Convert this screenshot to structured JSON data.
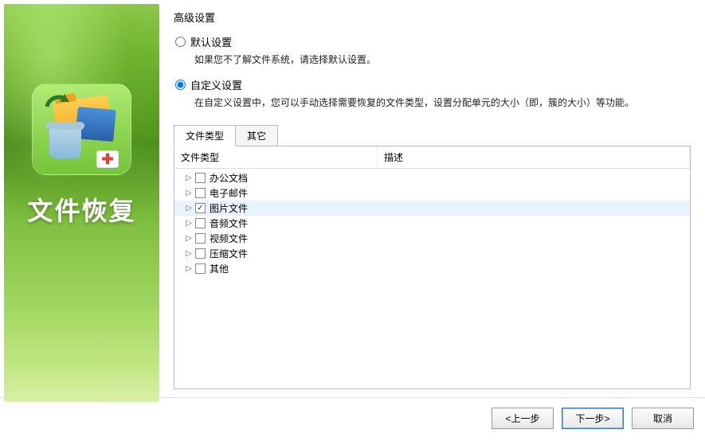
{
  "sidebar": {
    "title": "文件恢复"
  },
  "main": {
    "section_title": "高级设置",
    "options": {
      "default": {
        "label": "默认设置",
        "desc": "如果您不了解文件系统，请选择默认设置。",
        "selected": false
      },
      "custom": {
        "label": "自定义设置",
        "desc": "在自定义设置中，您可以手动选择需要恢复的文件类型，设置分配单元的大小（即，簇的大小）等功能。",
        "selected": true
      }
    },
    "tabs": [
      {
        "label": "文件类型",
        "active": true
      },
      {
        "label": "其它",
        "active": false
      }
    ],
    "columns": {
      "type": "文件类型",
      "desc": "描述"
    },
    "tree": [
      {
        "label": "办公文档",
        "checked": false,
        "selected": false
      },
      {
        "label": "电子邮件",
        "checked": false,
        "selected": false
      },
      {
        "label": "图片文件",
        "checked": true,
        "selected": true
      },
      {
        "label": "音频文件",
        "checked": false,
        "selected": false
      },
      {
        "label": "视频文件",
        "checked": false,
        "selected": false
      },
      {
        "label": "压缩文件",
        "checked": false,
        "selected": false
      },
      {
        "label": "其他",
        "checked": false,
        "selected": false
      }
    ]
  },
  "footer": {
    "back": "<上一步",
    "next": "下一步>",
    "cancel": "取消"
  }
}
